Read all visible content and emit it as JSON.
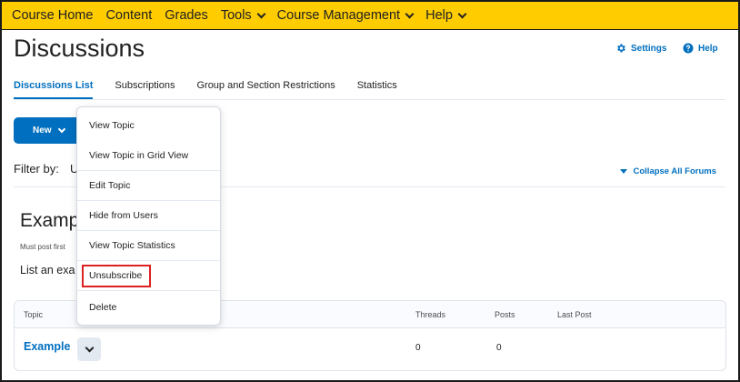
{
  "topnav": {
    "items": [
      {
        "label": "Course Home",
        "dropdown": false
      },
      {
        "label": "Content",
        "dropdown": false
      },
      {
        "label": "Grades",
        "dropdown": false
      },
      {
        "label": "Tools",
        "dropdown": true
      },
      {
        "label": "Course Management",
        "dropdown": true
      },
      {
        "label": "Help",
        "dropdown": true
      }
    ]
  },
  "header": {
    "title": "Discussions",
    "settings_label": "Settings",
    "help_label": "Help"
  },
  "tabs": [
    {
      "label": "Discussions List",
      "active": true
    },
    {
      "label": "Subscriptions",
      "active": false
    },
    {
      "label": "Group and Section Restrictions",
      "active": false
    },
    {
      "label": "Statistics",
      "active": false
    }
  ],
  "toolbar": {
    "new_label": "New",
    "filter_label": "Filter by:",
    "filter_value": "U",
    "collapse_label": "Collapse All Forums"
  },
  "forum": {
    "title": "Exampl",
    "note": "Must post first",
    "description": "List an exa"
  },
  "table": {
    "headers": {
      "topic": "Topic",
      "threads": "Threads",
      "posts": "Posts",
      "last_post": "Last Post"
    },
    "rows": [
      {
        "topic": "Example",
        "threads": "0",
        "posts": "0",
        "last_post": ""
      }
    ]
  },
  "context_menu": {
    "items": [
      "View Topic",
      "View Topic in Grid View",
      "Edit Topic",
      "Hide from Users",
      "View Topic Statistics",
      "Unsubscribe",
      "Delete"
    ],
    "highlighted": "Unsubscribe"
  },
  "colors": {
    "nav_bg": "#ffcc00",
    "accent": "#006fbf",
    "highlight_box": "#dd2222"
  },
  "icons": {
    "settings": "gear-icon",
    "help": "question-circle-icon",
    "dropdown": "chevron-down-icon",
    "collapse": "triangle-down-icon"
  }
}
